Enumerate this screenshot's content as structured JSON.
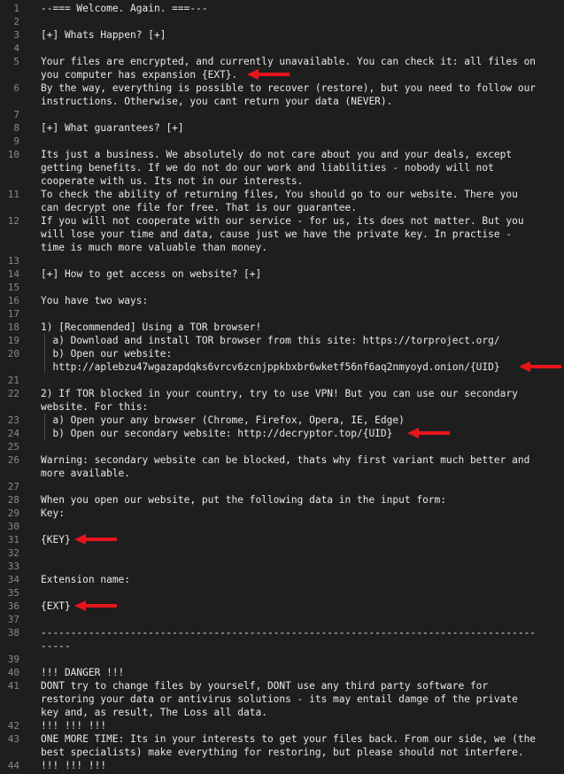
{
  "lines": [
    {
      "n": "1",
      "text": "--=== Welcome. Again. ===---"
    },
    {
      "n": "2",
      "text": ""
    },
    {
      "n": "3",
      "text": "[+] Whats Happen? [+]"
    },
    {
      "n": "4",
      "text": ""
    },
    {
      "n": "5",
      "text": "Your files are encrypted, and currently unavailable. You can check it: all files on"
    },
    {
      "n": "",
      "text": "you computer has expansion {EXT}."
    },
    {
      "n": "6",
      "text": "By the way, everything is possible to recover (restore), but you need to follow our"
    },
    {
      "n": "",
      "text": "instructions. Otherwise, you cant return your data (NEVER)."
    },
    {
      "n": "7",
      "text": ""
    },
    {
      "n": "8",
      "text": "[+] What guarantees? [+]"
    },
    {
      "n": "9",
      "text": ""
    },
    {
      "n": "10",
      "text": "Its just a business. We absolutely do not care about you and your deals, except"
    },
    {
      "n": "",
      "text": "getting benefits. If we do not do our work and liabilities - nobody will not"
    },
    {
      "n": "",
      "text": "cooperate with us. Its not in our interests."
    },
    {
      "n": "11",
      "text": "To check the ability of returning files, You should go to our website. There you"
    },
    {
      "n": "",
      "text": "can decrypt one file for free. That is our guarantee."
    },
    {
      "n": "12",
      "text": "If you will not cooperate with our service - for us, its does not matter. But you"
    },
    {
      "n": "",
      "text": "will lose your time and data, cause just we have the private key. In practise -"
    },
    {
      "n": "",
      "text": "time is much more valuable than money."
    },
    {
      "n": "13",
      "text": ""
    },
    {
      "n": "14",
      "text": "[+] How to get access on website? [+]"
    },
    {
      "n": "15",
      "text": ""
    },
    {
      "n": "16",
      "text": "You have two ways:"
    },
    {
      "n": "17",
      "text": ""
    },
    {
      "n": "18",
      "text": "1) [Recommended] Using a TOR browser!"
    },
    {
      "n": "19",
      "text": "  a) Download and install TOR browser from this site: https://torproject.org/"
    },
    {
      "n": "20",
      "text": "  b) Open our website:"
    },
    {
      "n": "",
      "text": "  http://aplebzu47wgazapdqks6vrcv6zcnjppkbxbr6wketf56nf6aq2nmyoyd.onion/{UID}"
    },
    {
      "n": "21",
      "text": ""
    },
    {
      "n": "22",
      "text": "2) If TOR blocked in your country, try to use VPN! But you can use our secondary"
    },
    {
      "n": "",
      "text": "website. For this:"
    },
    {
      "n": "23",
      "text": "  a) Open your any browser (Chrome, Firefox, Opera, IE, Edge)"
    },
    {
      "n": "24",
      "text": "  b) Open our secondary website: http://decryptor.top/{UID}"
    },
    {
      "n": "25",
      "text": ""
    },
    {
      "n": "26",
      "text": "Warning: secondary website can be blocked, thats why first variant much better and"
    },
    {
      "n": "",
      "text": "more available."
    },
    {
      "n": "27",
      "text": ""
    },
    {
      "n": "28",
      "text": "When you open our website, put the following data in the input form:"
    },
    {
      "n": "29",
      "text": "Key:"
    },
    {
      "n": "30",
      "text": ""
    },
    {
      "n": "31",
      "text": "{KEY}"
    },
    {
      "n": "32",
      "text": ""
    },
    {
      "n": "33",
      "text": ""
    },
    {
      "n": "34",
      "text": "Extension name:"
    },
    {
      "n": "35",
      "text": ""
    },
    {
      "n": "36",
      "text": "{EXT}"
    },
    {
      "n": "37",
      "text": ""
    },
    {
      "n": "38",
      "text": "-----------------------------------------------------------------------------------"
    },
    {
      "n": "",
      "text": "-----"
    },
    {
      "n": "39",
      "text": ""
    },
    {
      "n": "40",
      "text": "!!! DANGER !!!"
    },
    {
      "n": "41",
      "text": "DONT try to change files by yourself, DONT use any third party software for"
    },
    {
      "n": "",
      "text": "restoring your data or antivirus solutions - its may entail damge of the private"
    },
    {
      "n": "",
      "text": "key and, as result, The Loss all data."
    },
    {
      "n": "42",
      "text": "!!! !!! !!!"
    },
    {
      "n": "43",
      "text": "ONE MORE TIME: Its in your interests to get your files back. From our side, we (the"
    },
    {
      "n": "",
      "text": "best specialists) make everything for restoring, but please should not interfere."
    },
    {
      "n": "44",
      "text": "!!! !!! !!!"
    }
  ],
  "colors": {
    "background": "#1e1e1e",
    "text": "#e8e8e8",
    "line_numbers": "#8a8a8a",
    "arrow": "#e8141b"
  }
}
